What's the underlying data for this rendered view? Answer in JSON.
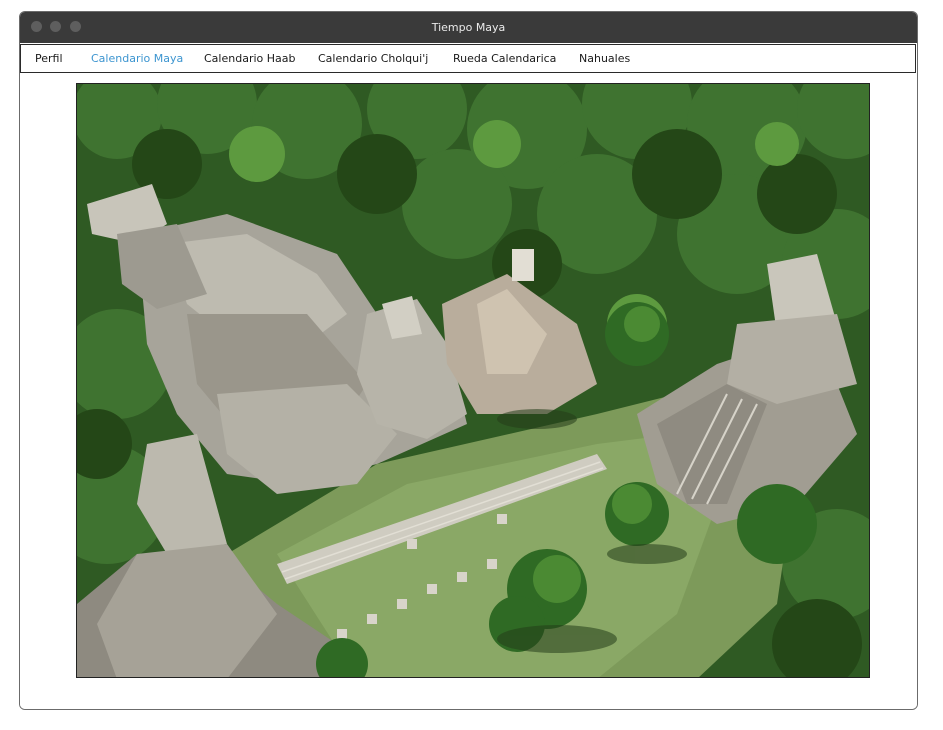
{
  "window": {
    "title": "Tiempo Maya"
  },
  "menu": {
    "items": [
      {
        "label": "Perfil",
        "active": false
      },
      {
        "label": "Calendario Maya",
        "active": true
      },
      {
        "label": "Calendario Haab",
        "active": false
      },
      {
        "label": "Calendario Cholqui'j",
        "active": false
      },
      {
        "label": "Rueda Calendarica",
        "active": false
      },
      {
        "label": "Nahuales",
        "active": false
      }
    ]
  },
  "colors": {
    "titlebar": "#3a3a3a",
    "active_menu": "#3d95d0",
    "menu_text": "#1a1a1a"
  },
  "main": {
    "image_icon": "maya-ruins-photo"
  }
}
